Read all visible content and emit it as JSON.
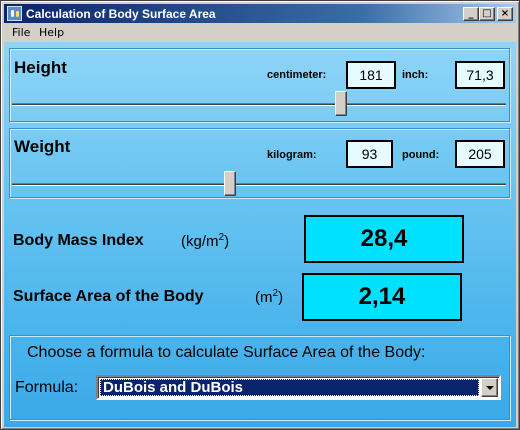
{
  "window": {
    "title": "Calculation of Body Surface Area",
    "buttons": {
      "minimize": "_",
      "maximize": "□",
      "close": "×"
    }
  },
  "menu": [
    "File",
    "Help"
  ],
  "height": {
    "title": "Height",
    "cm_label": "centimeter:",
    "cm_value": "181",
    "inch_label": "inch:",
    "inch_value": "71,3",
    "slider_position": 0.67
  },
  "weight": {
    "title": "Weight",
    "kg_label": "kilogram:",
    "kg_value": "93",
    "pound_label": "pound:",
    "pound_value": "205",
    "slider_position": 0.44
  },
  "bmi": {
    "label": "Body Mass Index",
    "unit_prefix": "(kg/m",
    "unit_sup": "2",
    "unit_suffix": ")",
    "value": "28,4"
  },
  "bsa": {
    "label": "Surface Area of the Body",
    "unit_prefix": "(m",
    "unit_sup": "2",
    "unit_suffix": ")",
    "value": "2,14"
  },
  "formula": {
    "prompt": "Choose a formula to calculate Surface Area of the Body:",
    "label": "Formula:",
    "selected": "DuBois and DuBois"
  },
  "colors": {
    "title_bar": "#0a246a",
    "result_box": "#00e0ff",
    "input_box": "#e6fbff",
    "client_top": "#8fd5f7",
    "client_bottom": "#3aa8e8"
  }
}
